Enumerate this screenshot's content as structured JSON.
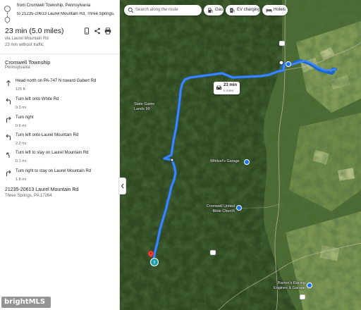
{
  "route": {
    "from": "from Cromwell Township, Pennsylvania",
    "to": "to 21235-20613 Laurel Mountain Rd, Three Springs, PA 17264",
    "summary": "23 min (5.0 miles)",
    "via": "via Laurel Mountain Rd",
    "without_traffic": "23 min without traffic",
    "tools": [
      "send-to-phone-icon",
      "share-icon",
      "print-icon"
    ]
  },
  "origin": {
    "name": "Cromwell Township",
    "state": "Pennsylvania"
  },
  "steps": [
    {
      "icon": "straight-arrow-icon",
      "text": "Head north on PA-747 N toward Gabert Rd",
      "distance": "125 ft"
    },
    {
      "icon": "turn-left-icon",
      "text": "Turn left onto White Rd",
      "distance": "0.3 mi"
    },
    {
      "icon": "turn-right-icon",
      "text": "Turn right",
      "distance": "0.6 mi"
    },
    {
      "icon": "turn-left-icon",
      "text": "Turn left onto Laurel Mountain Rd",
      "distance": "2.2 mi"
    },
    {
      "icon": "slight-left-icon",
      "text": "Turn left to stay on Laurel Mountain Rd",
      "distance": "0.1 mi"
    },
    {
      "icon": "turn-right-icon",
      "text": "Turn right to stay on Laurel Mountain Rd",
      "distance": "1.8 mi"
    }
  ],
  "destination": {
    "name": "21235-20613 Laurel Mountain Rd",
    "city": "Three Springs, PA 17264"
  },
  "map": {
    "search_placeholder": "Search along the route",
    "chips": [
      {
        "icon": "gas-station-icon",
        "label": "Gas"
      },
      {
        "icon": "ev-charging-icon",
        "label": "EV charging"
      },
      {
        "icon": "hotel-icon",
        "label": "Hotels"
      }
    ],
    "time_badge": {
      "time": "23 min",
      "distance": "5 miles"
    },
    "labels": {
      "state_game_lands": "State Game Lands 99",
      "whitsels_garage": "Whitsel's Garage",
      "church": "Cromwell United Bible Church",
      "racing": "Barron's Racing Engines & Garage"
    },
    "route_color": "#4285f4",
    "forest_color": "#2f4a22",
    "field_color": "#8fa268"
  },
  "watermark": "brightMLS"
}
